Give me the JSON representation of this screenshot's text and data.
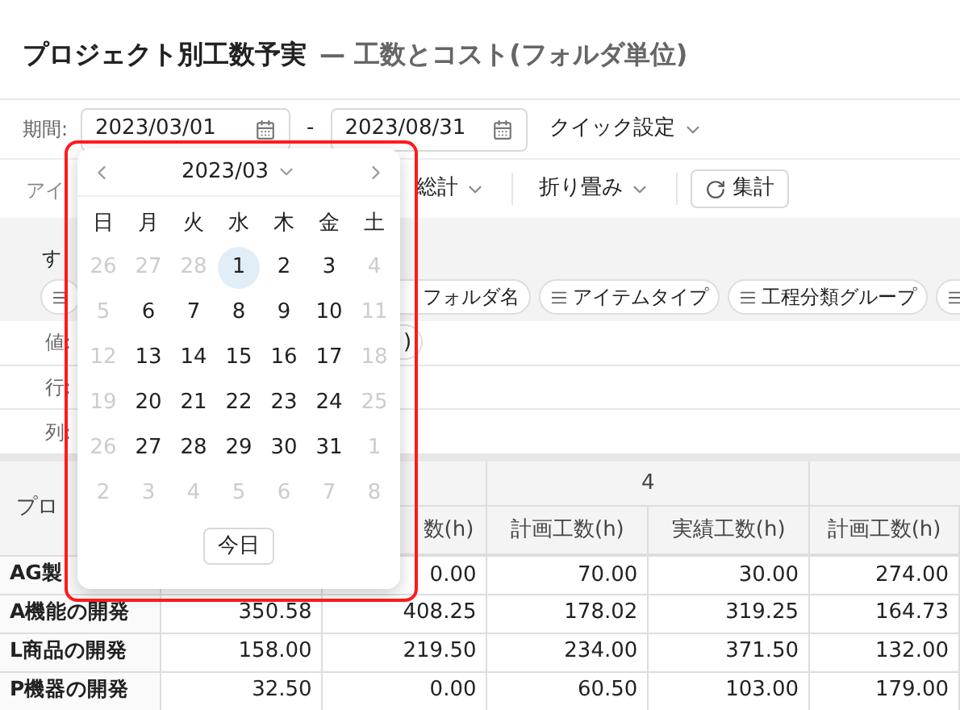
{
  "title": {
    "main": "プロジェクト別工数予実",
    "sub": "— 工数とコスト(フォルダ単位)"
  },
  "period": {
    "label": "期間:",
    "start": "2023/03/01",
    "separator": "-",
    "end": "2023/08/31",
    "quick": "クイック設定"
  },
  "toolbar": [
    {
      "kind": "text",
      "label": "アイ"
    },
    {
      "kind": "dropdown",
      "label": "総計"
    },
    {
      "kind": "dropdown",
      "label": "折り畳み"
    },
    {
      "kind": "button",
      "label": "集計"
    }
  ],
  "fields_panel": {
    "heading": "す",
    "chips": [
      {
        "partial": true
      },
      {
        "label": "フォルダ名"
      },
      {
        "label": "アイテムタイプ"
      },
      {
        "label": "工程分類グループ"
      },
      {
        "partial": true
      }
    ],
    "rows": [
      {
        "label": "値:",
        "chip": ")"
      },
      {
        "label": "行:"
      },
      {
        "label": "列:"
      }
    ]
  },
  "table": {
    "corner": "プロ",
    "group": "4",
    "columns": [
      "数(h)",
      "計画工数(h)",
      "実績工数(h)",
      "計画工数(h)"
    ],
    "rows": [
      {
        "name": "AG製",
        "cells": [
          "0.00",
          "70.00",
          "30.00",
          "274.00"
        ]
      },
      {
        "name": "A機能の開発",
        "cells": [
          "350.58",
          "408.25",
          "178.02",
          "319.25",
          "164.73"
        ]
      },
      {
        "name": "L商品の開発",
        "cells": [
          "158.00",
          "219.50",
          "234.00",
          "371.50",
          "132.00"
        ]
      },
      {
        "name": "P機器の開発",
        "cells": [
          "32.50",
          "0.00",
          "60.50",
          "103.00",
          "179.00"
        ]
      }
    ]
  },
  "calendar": {
    "month": "2023/03",
    "weekdays": [
      "日",
      "月",
      "火",
      "水",
      "木",
      "金",
      "土"
    ],
    "weeks": [
      [
        {
          "day": "26",
          "disabled": true,
          "selected": false
        },
        {
          "day": "27",
          "disabled": true,
          "selected": false
        },
        {
          "day": "28",
          "disabled": true,
          "selected": false
        },
        {
          "day": "1",
          "disabled": false,
          "selected": true
        },
        {
          "day": "2",
          "disabled": false,
          "selected": false
        },
        {
          "day": "3",
          "disabled": false,
          "selected": false
        },
        {
          "day": "4",
          "disabled": true,
          "selected": false
        }
      ],
      [
        {
          "day": "5",
          "disabled": true,
          "selected": false
        },
        {
          "day": "6",
          "disabled": false,
          "selected": false
        },
        {
          "day": "7",
          "disabled": false,
          "selected": false
        },
        {
          "day": "8",
          "disabled": false,
          "selected": false
        },
        {
          "day": "9",
          "disabled": false,
          "selected": false
        },
        {
          "day": "10",
          "disabled": false,
          "selected": false
        },
        {
          "day": "11",
          "disabled": true,
          "selected": false
        }
      ],
      [
        {
          "day": "12",
          "disabled": true,
          "selected": false
        },
        {
          "day": "13",
          "disabled": false,
          "selected": false
        },
        {
          "day": "14",
          "disabled": false,
          "selected": false
        },
        {
          "day": "15",
          "disabled": false,
          "selected": false
        },
        {
          "day": "16",
          "disabled": false,
          "selected": false
        },
        {
          "day": "17",
          "disabled": false,
          "selected": false
        },
        {
          "day": "18",
          "disabled": true,
          "selected": false
        }
      ],
      [
        {
          "day": "19",
          "disabled": true,
          "selected": false
        },
        {
          "day": "20",
          "disabled": false,
          "selected": false
        },
        {
          "day": "21",
          "disabled": false,
          "selected": false
        },
        {
          "day": "22",
          "disabled": false,
          "selected": false
        },
        {
          "day": "23",
          "disabled": false,
          "selected": false
        },
        {
          "day": "24",
          "disabled": false,
          "selected": false
        },
        {
          "day": "25",
          "disabled": true,
          "selected": false
        }
      ],
      [
        {
          "day": "26",
          "disabled": true,
          "selected": false
        },
        {
          "day": "27",
          "disabled": false,
          "selected": false
        },
        {
          "day": "28",
          "disabled": false,
          "selected": false
        },
        {
          "day": "29",
          "disabled": false,
          "selected": false
        },
        {
          "day": "30",
          "disabled": false,
          "selected": false
        },
        {
          "day": "31",
          "disabled": false,
          "selected": false
        },
        {
          "day": "1",
          "disabled": true,
          "selected": false
        }
      ],
      [
        {
          "day": "2",
          "disabled": true,
          "selected": false
        },
        {
          "day": "3",
          "disabled": true,
          "selected": false
        },
        {
          "day": "4",
          "disabled": true,
          "selected": false
        },
        {
          "day": "5",
          "disabled": true,
          "selected": false
        },
        {
          "day": "6",
          "disabled": true,
          "selected": false
        },
        {
          "day": "7",
          "disabled": true,
          "selected": false
        },
        {
          "day": "8",
          "disabled": true,
          "selected": false
        }
      ]
    ],
    "today_button": "今日"
  }
}
